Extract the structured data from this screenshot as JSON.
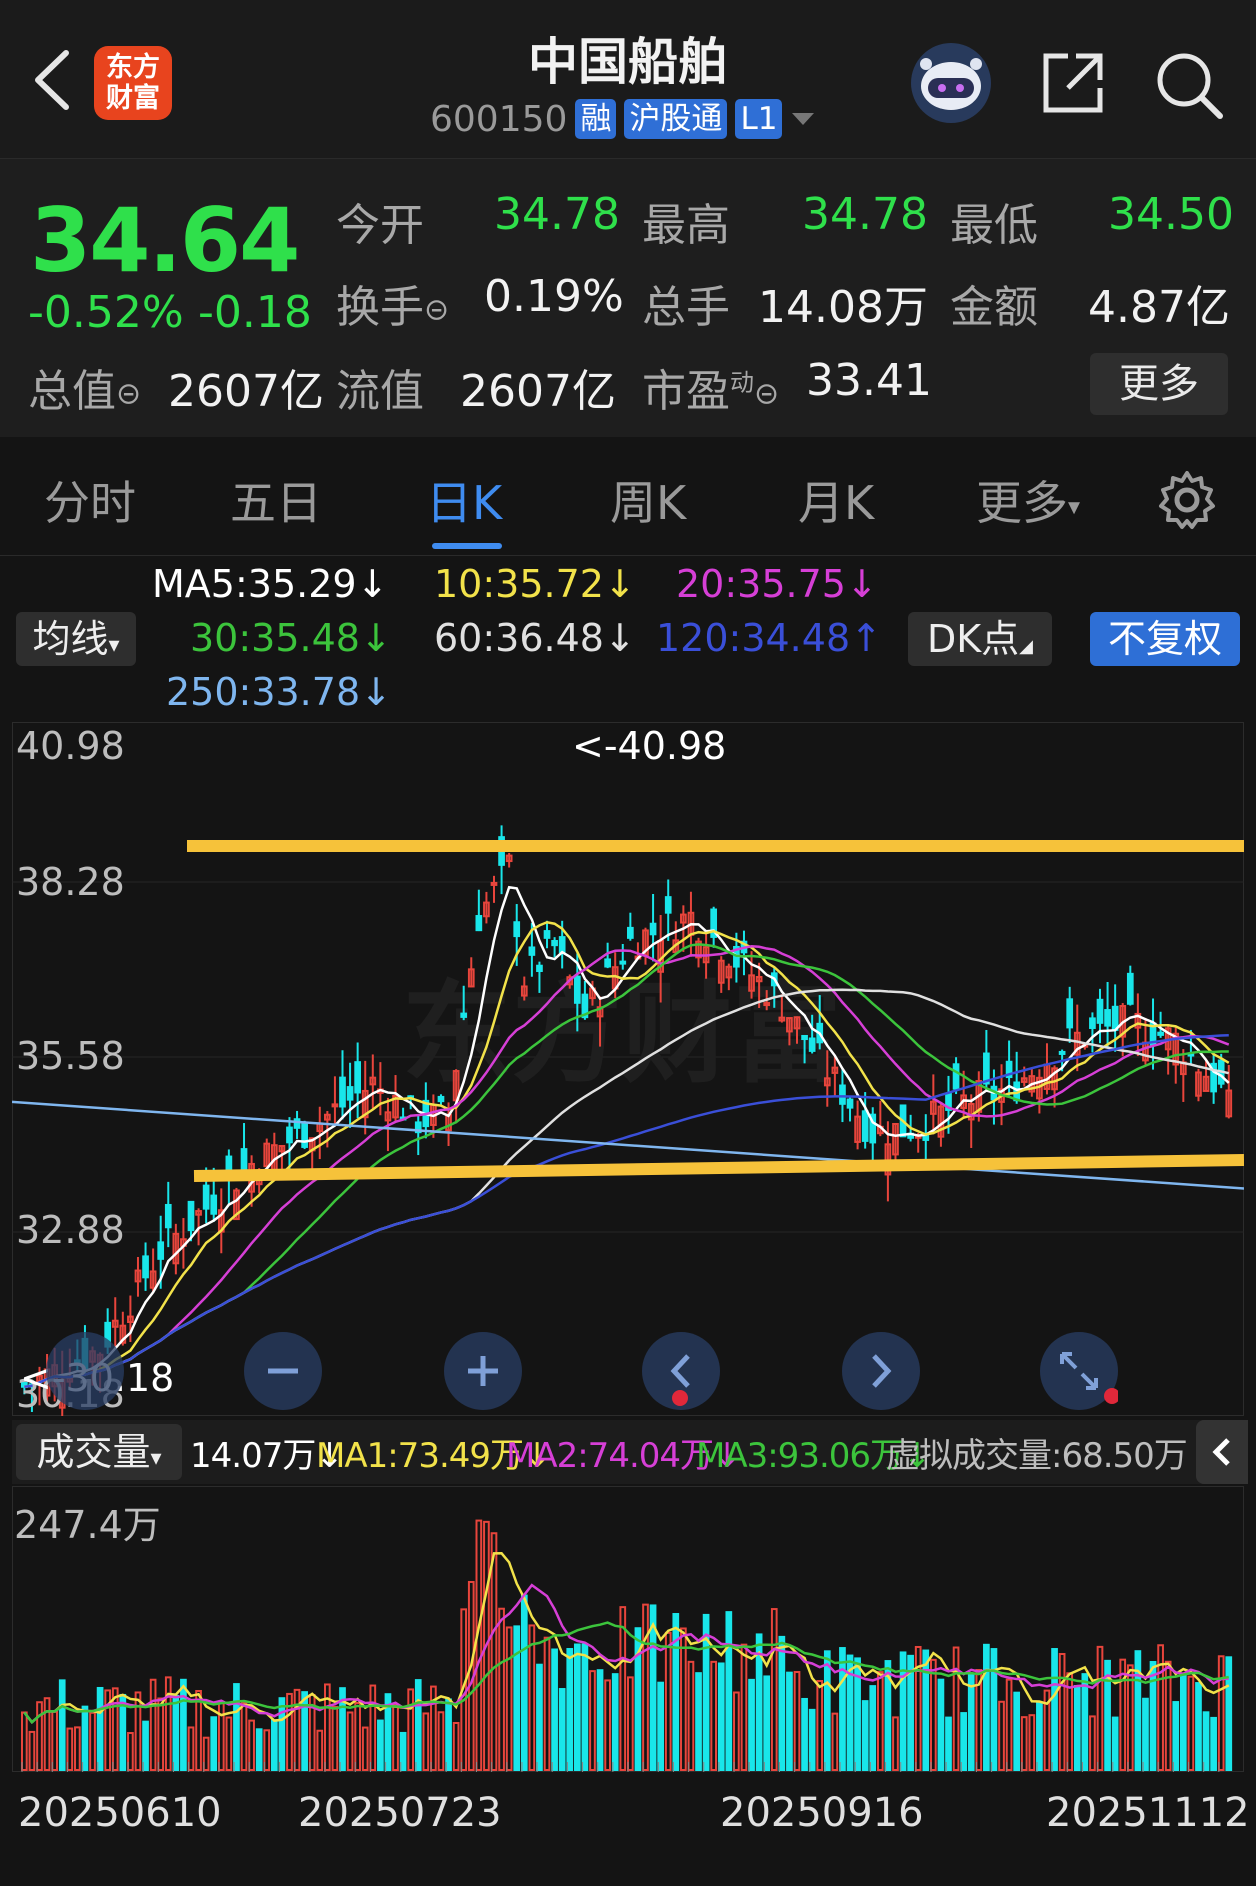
{
  "header": {
    "title": "中国船舶",
    "code": "600150",
    "tags": [
      "融",
      "沪股通",
      "L1"
    ],
    "logo_text": "东方\n财富"
  },
  "quote": {
    "price": "34.64",
    "pct": "-0.52%",
    "chg": "-0.18",
    "open_label": "今开",
    "open": "34.78",
    "high_label": "最高",
    "high": "34.78",
    "low_label": "最低",
    "low": "34.50",
    "turnover_label": "换手",
    "turnover": "0.19%",
    "volume_label": "总手",
    "volume": "14.08万",
    "amount_label": "金额",
    "amount": "4.87亿",
    "mcap_label": "总值",
    "mcap": "2607亿",
    "float_label": "流值",
    "float": "2607亿",
    "pe_label": "市盈",
    "pe_sup": "动",
    "pe": "33.41",
    "more": "更多"
  },
  "tabs": [
    "分时",
    "五日",
    "日K",
    "周K",
    "月K",
    "更多"
  ],
  "ma_legend": {
    "ma_btn": "均线",
    "ma5": "MA5:35.29↓",
    "ma10": "10:35.72↓",
    "ma20": "20:35.75↓",
    "ma30": "30:35.48↓",
    "ma60": "60:36.48↓",
    "ma120": "120:34.48↑",
    "ma250": "250:33.78↓",
    "dk": "DK点",
    "fuquan": "不复权"
  },
  "colors": {
    "up": "#e8453c",
    "down": "#19e6ea",
    "ma5": "#ffffff",
    "ma10": "#f2e24a",
    "ma20": "#d63fd6",
    "ma30": "#3cc43c",
    "ma60": "#e0e0e0",
    "ma120": "#3a4fd8",
    "ma250": "#7fb6ef",
    "line": "#f6c23a"
  },
  "kchart": {
    "y_labels": [
      "40.98",
      "38.28",
      "35.58",
      "32.88",
      "30.18"
    ],
    "max_label": "<-40.98",
    "min_label": "<-30.18"
  },
  "volume": {
    "btn": "成交量",
    "cur": "14.07万↓",
    "ma1": "MA1:73.49万↓",
    "ma2": "MA2:74.04万↓",
    "ma3": "MA3:93.06万↓",
    "virtual": "虚拟成交量:68.50万",
    "max_label": "247.4万"
  },
  "dates": [
    "20250610",
    "20250723",
    "20250916",
    "20251112"
  ],
  "chart_data": {
    "type": "candlestick",
    "x_range": [
      "20250610",
      "20251112"
    ],
    "ylim": [
      30.18,
      40.98
    ],
    "high": 40.98,
    "low": 30.18,
    "volume_max": "247.4万"
  }
}
